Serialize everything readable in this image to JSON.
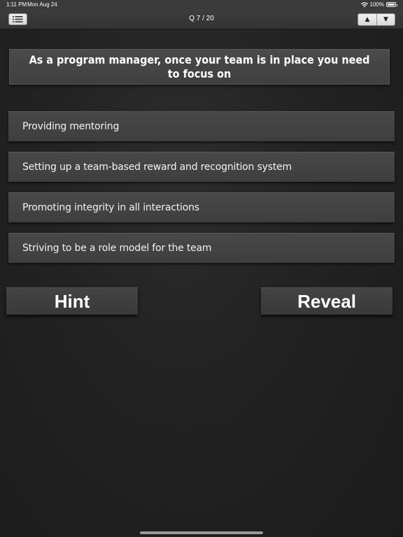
{
  "status_bar": {
    "time": "1:11 PM",
    "date": "Mon Aug 24",
    "battery": "100%",
    "battery_level": 1.0
  },
  "nav": {
    "menu_icon": "list-icon",
    "title": "Q 7 / 20",
    "prev_symbol": "▲",
    "next_symbol": "▼"
  },
  "question": {
    "text": "As a program manager, once your team is in place you need to focus on"
  },
  "answers": [
    {
      "label": "Providing mentoring"
    },
    {
      "label": "Setting up a team-based reward and recognition system"
    },
    {
      "label": "Promoting integrity in all interactions"
    },
    {
      "label": "Striving to be a role model for the team"
    }
  ],
  "actions": {
    "hint_label": "Hint",
    "reveal_label": "Reveal"
  },
  "colors": {
    "background": "#222222",
    "card": "#454545",
    "nav_bar": "#383838",
    "text": "#ffffff"
  }
}
